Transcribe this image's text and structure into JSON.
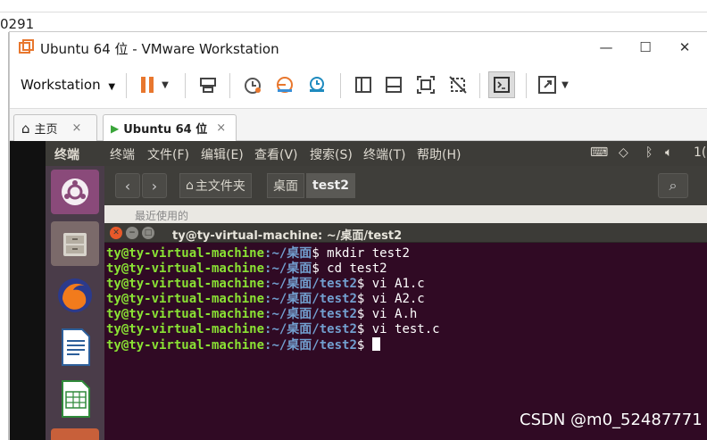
{
  "host": {
    "fragment_number": "0291"
  },
  "window": {
    "title": "Ubuntu 64 位 - VMware Workstation",
    "controls": {
      "minimize": "—",
      "maximize": "☐",
      "close": "✕"
    }
  },
  "toolbar": {
    "workstation_menu": "Workstation",
    "icons": [
      "pause-icon",
      "send-keys-icon",
      "snapshot-icon",
      "revert-snapshot-icon",
      "snapshot-manager-icon",
      "full-view-icon",
      "console-view-icon",
      "fit-guest-icon",
      "unity-icon",
      "terminal-view-icon",
      "stretch-icon"
    ]
  },
  "tabs": [
    {
      "label": "主页",
      "close": "×"
    },
    {
      "label": "Ubuntu 64 位",
      "close": "×"
    }
  ],
  "ubuntu": {
    "topbar_app": "终端",
    "menus": [
      "终端",
      "文件(F)",
      "编辑(E)",
      "查看(V)",
      "搜索(S)",
      "终端(T)",
      "帮助(H)"
    ],
    "clock_fragment": "1(",
    "breadcrumbs": [
      "主文件夹",
      "桌面",
      "test2"
    ],
    "sidebar_partial": "最近使用的"
  },
  "terminal": {
    "title": "ty@ty-virtual-machine: ~/桌面/test2",
    "lines": [
      {
        "user": "ty@ty-virtual-machine",
        "path": ":~/桌面",
        "cmd": "$ mkdir test2"
      },
      {
        "user": "ty@ty-virtual-machine",
        "path": ":~/桌面",
        "cmd": "$ cd test2"
      },
      {
        "user": "ty@ty-virtual-machine",
        "path": ":~/桌面/test2",
        "cmd": "$ vi A1.c"
      },
      {
        "user": "ty@ty-virtual-machine",
        "path": ":~/桌面/test2",
        "cmd": "$ vi A2.c"
      },
      {
        "user": "ty@ty-virtual-machine",
        "path": ":~/桌面/test2",
        "cmd": "$ vi A.h"
      },
      {
        "user": "ty@ty-virtual-machine",
        "path": ":~/桌面/test2",
        "cmd": "$ vi test.c"
      },
      {
        "user": "ty@ty-virtual-machine",
        "path": ":~/桌面/test2",
        "cmd": "$ "
      }
    ]
  },
  "watermark": "CSDN @m0_52487771",
  "colors": {
    "terminal_bg": "#300a24",
    "prompt_user": "#8ae234",
    "prompt_path": "#729fcf",
    "accent_orange": "#e8772e"
  }
}
